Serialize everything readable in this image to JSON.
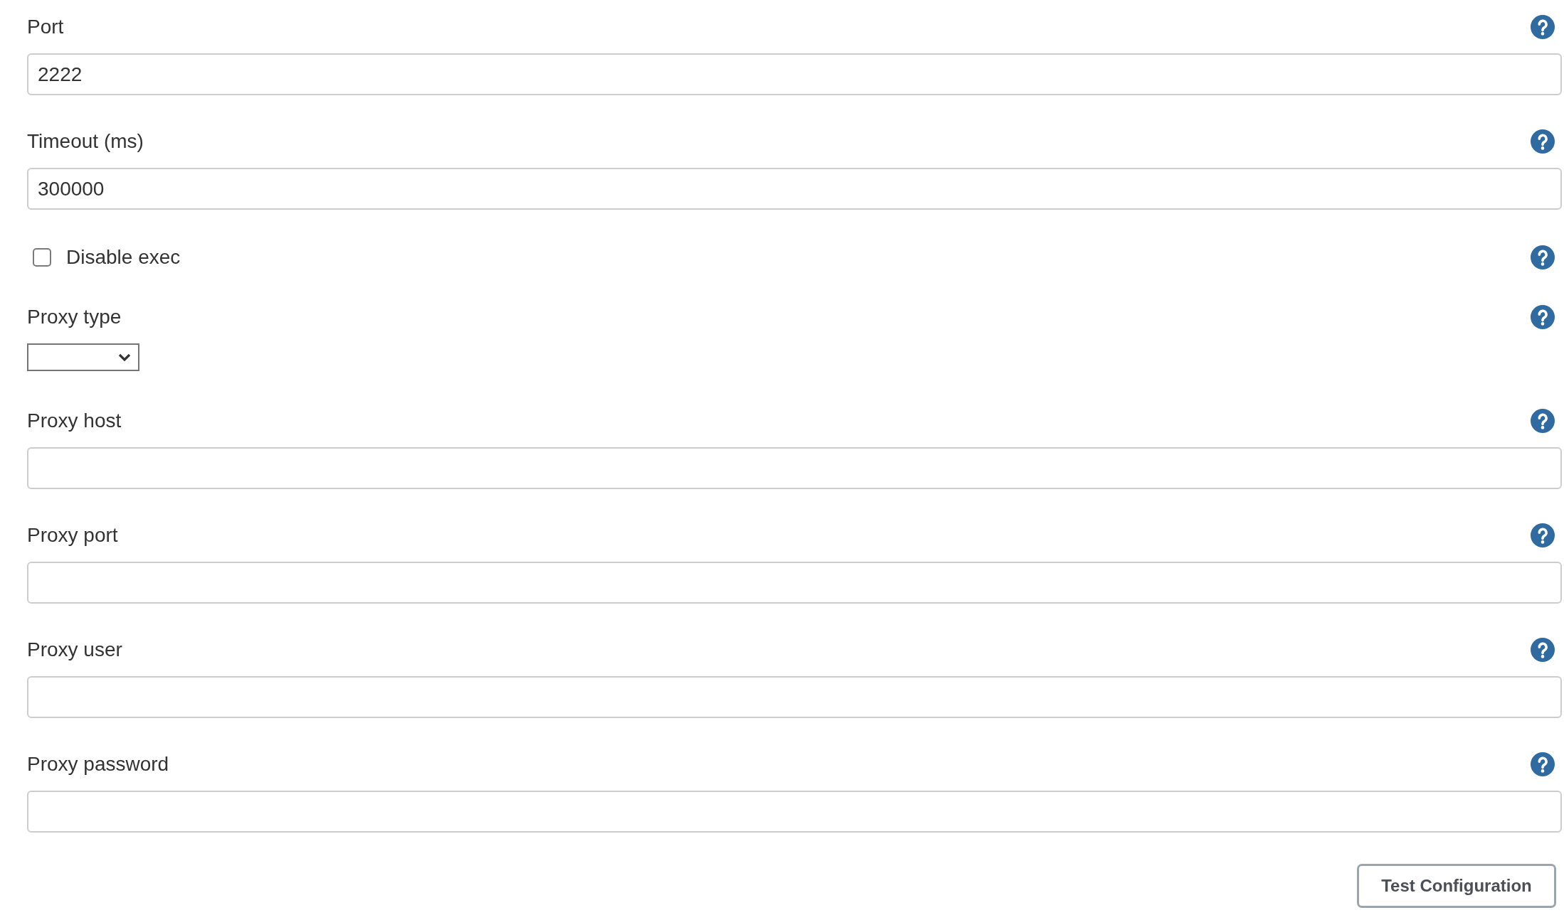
{
  "fields": [
    {
      "kind": "text",
      "label": "Port",
      "value": "2222"
    },
    {
      "kind": "text",
      "label": "Timeout (ms)",
      "value": "300000"
    },
    {
      "kind": "checkbox",
      "label": "Disable exec",
      "checked": false
    },
    {
      "kind": "select",
      "label": "Proxy type"
    },
    {
      "kind": "text",
      "label": "Proxy host"
    },
    {
      "kind": "text",
      "label": "Proxy port"
    },
    {
      "kind": "text",
      "label": "Proxy user"
    },
    {
      "kind": "text",
      "label": "Proxy password"
    }
  ],
  "buttons": [
    {
      "label": "Test Configuration"
    }
  ]
}
